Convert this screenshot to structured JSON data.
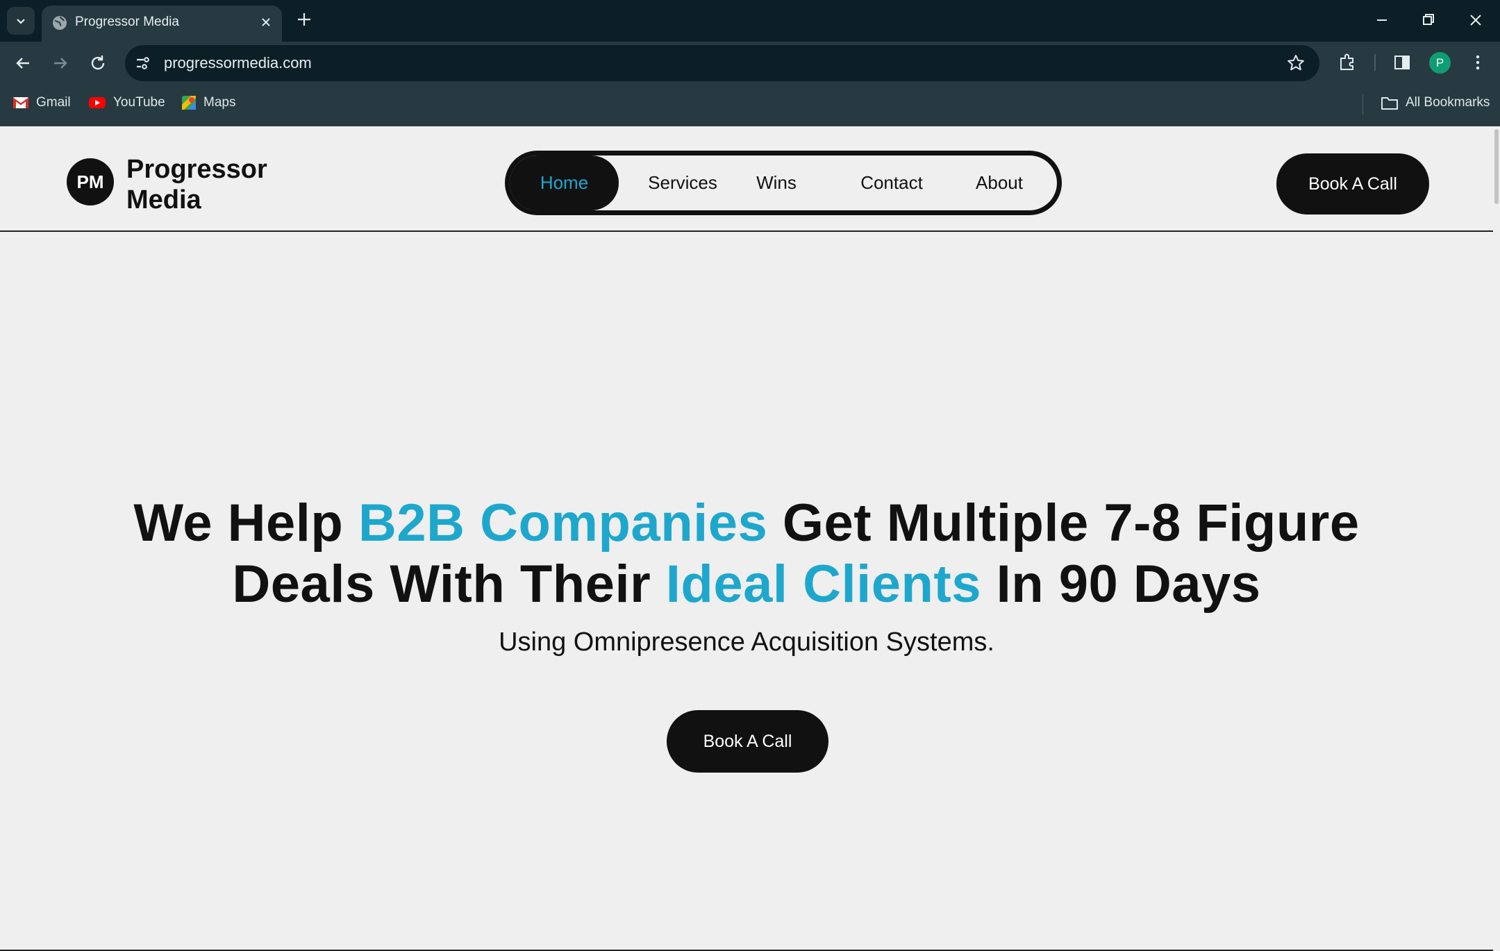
{
  "browser": {
    "tab": {
      "title": "Progressor Media"
    },
    "omnibox": {
      "url": "progressormedia.com"
    },
    "profile_initial": "P",
    "bookmarks": [
      {
        "label": "Gmail",
        "icon": "gmail-icon"
      },
      {
        "label": "YouTube",
        "icon": "youtube-icon"
      },
      {
        "label": "Maps",
        "icon": "maps-icon"
      }
    ],
    "all_bookmarks_label": "All Bookmarks"
  },
  "site": {
    "logo": {
      "mark": "PM",
      "name_line1": "Progressor",
      "name_line2": "Media"
    },
    "nav": [
      {
        "label": "Home",
        "active": true
      },
      {
        "label": "Services"
      },
      {
        "label": "Wins"
      },
      {
        "label": "Contact"
      },
      {
        "label": "About"
      }
    ],
    "header_cta": "Book A Call",
    "accent_color": "#1ea7cd",
    "hero": {
      "line1_pre": "We Help ",
      "line1_accent": "B2B Companies",
      "line1_post": " Get Multiple 7-8 Figure",
      "line2_pre": "Deals With Their ",
      "line2_accent": "Ideal Clients",
      "line2_post": " In 90 Days",
      "subtitle": "Using Omnipresence Acquisition Systems.",
      "cta": "Book A Call"
    }
  }
}
